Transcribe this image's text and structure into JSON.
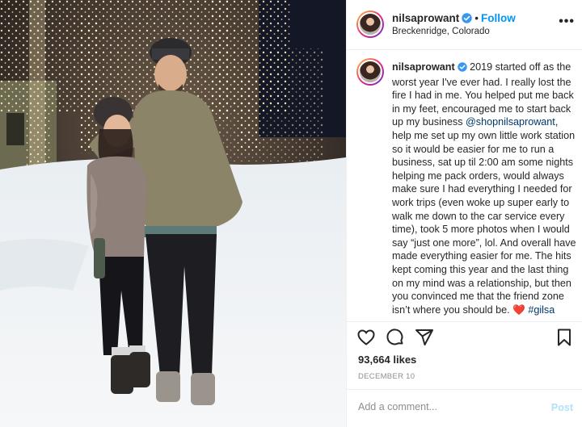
{
  "post": {
    "username": "nilsaprowant",
    "follow_label": "Follow",
    "location": "Breckenridge, Colorado",
    "caption": {
      "username": "nilsaprowant",
      "text_before_mention": " 2019 started off as the worst year I've ever had. I really lost the fire I had in me. You helped put me back in my feet, encouraged me to start back up my business ",
      "mention": "@shopnilsaprowant",
      "text_after_mention": ", help me set up my own little work station so it would be easier for me to run a business, sat up til 2:00 am some nights helping me pack orders, would always make sure I had everything I needed for work trips (even woke up super early to walk me down to the car service every time), took 5 more photos when I would say “just one more”, lol. And overall have made everything easier for me. The hits kept coming this year and the last thing on my mind was a relationship, but then you convinced me that the friend zone isn’t where you should be. ",
      "emoji": "❤️",
      "hashtag": "#gilsa"
    },
    "likes": "93,664 likes",
    "date": "DECEMBER 10",
    "comment_placeholder": "Add a comment...",
    "post_label": "Post",
    "colors": {
      "link_blue": "#0095f6",
      "mention_blue": "#00376b",
      "muted": "#8e8e8e",
      "post_disabled": "#b2dffc"
    },
    "icons": [
      "verified-badge-icon",
      "more-options-icon",
      "heart-icon",
      "comment-icon",
      "share-icon",
      "bookmark-icon"
    ]
  }
}
